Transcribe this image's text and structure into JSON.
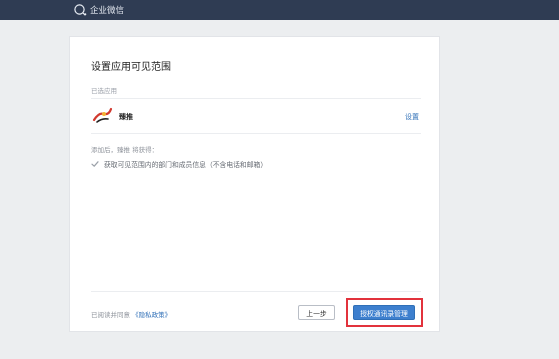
{
  "header": {
    "brand": "企业微信",
    "logo_icon": "wechat-work-icon"
  },
  "card": {
    "title": "设置应用可见范围",
    "selected_label": "已选应用",
    "app": {
      "name": "臻推",
      "icon": "zhentui-app-icon"
    },
    "settings_link": "设置",
    "after_add_text": "添加后，臻推 将获得：",
    "permission": {
      "text": "获取可见范围内的部门和成员信息（不含电话和邮箱）",
      "checked": true
    },
    "agree_prefix": "已阅读并同意",
    "policy_link": "《隐私政策》",
    "prev_button": "上一步",
    "auth_button": "授权通讯录管理"
  },
  "colors": {
    "topbar": "#2f3c53",
    "accent": "#3d7fce",
    "highlight": "#e2323c"
  }
}
